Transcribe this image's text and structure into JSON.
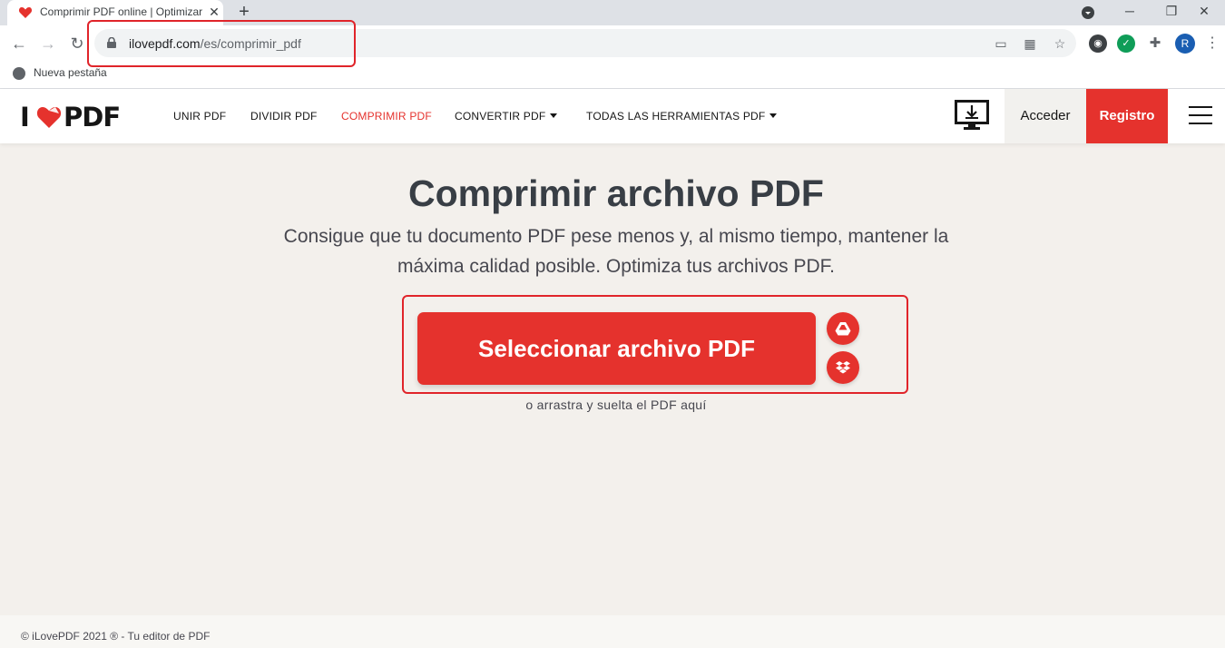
{
  "browser": {
    "tab_title": "Comprimir PDF online | Optimizar",
    "tab_close": "✕",
    "new_tab": "+",
    "url_host": "ilovepdf.com",
    "url_path": "/es/comprimir_pdf",
    "profile_initial": "R",
    "bookmark": "Nueva pestaña"
  },
  "header": {
    "logo_left": "I",
    "logo_right": "PDF",
    "nav": {
      "merge": "UNIR PDF",
      "split": "DIVIDIR PDF",
      "compress": "COMPRIMIR PDF",
      "convert": "CONVERTIR PDF",
      "all_tools": "TODAS LAS HERRAMIENTAS PDF"
    },
    "login": "Acceder",
    "signup": "Registro"
  },
  "main": {
    "title": "Comprimir archivo PDF",
    "subtitle_line1": "Consigue que tu documento PDF pese menos y, al mismo tiempo, mantener la",
    "subtitle_line2": "máxima calidad posible. Optimiza tus archivos PDF.",
    "select_button": "Seleccionar archivo PDF",
    "drop_text": "o arrastra y suelta el PDF aquí"
  },
  "footer": {
    "text": "© iLovePDF 2021 ® - Tu editor de PDF"
  },
  "colors": {
    "brand_red": "#e5322d",
    "page_bg": "#f3f0ec"
  },
  "icons": [
    "heart-favicon-icon",
    "lock-icon",
    "google-drive-icon",
    "dropbox-icon",
    "desktop-download-icon",
    "hamburger-menu-icon"
  ]
}
